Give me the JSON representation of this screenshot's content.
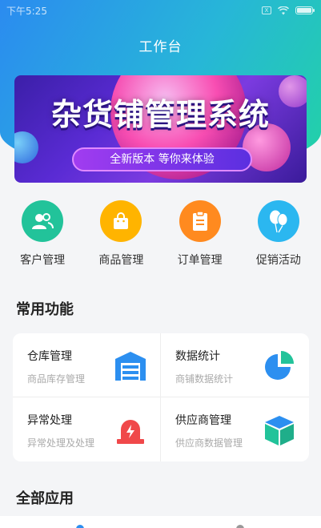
{
  "status_bar": {
    "time": "下午5:25",
    "sim_label": "X"
  },
  "header": {
    "title": "工作台"
  },
  "banner": {
    "title": "杂货铺管理系统",
    "subtitle": "全新版本 等你来体验"
  },
  "quick_actions": [
    {
      "label": "客户管理",
      "icon": "users-icon",
      "color": "#22c39a"
    },
    {
      "label": "商品管理",
      "icon": "shopping-bag-icon",
      "color": "#ffb400"
    },
    {
      "label": "订单管理",
      "icon": "clipboard-icon",
      "color": "#ff8a1f"
    },
    {
      "label": "促销活动",
      "icon": "balloons-icon",
      "color": "#2bb7f0"
    }
  ],
  "common": {
    "title": "常用功能",
    "items": [
      {
        "name": "仓库管理",
        "desc": "商品库存管理",
        "icon": "warehouse-icon"
      },
      {
        "name": "数据统计",
        "desc": "商铺数据统计",
        "icon": "pie-chart-icon"
      },
      {
        "name": "异常处理",
        "desc": "异常处理及处理",
        "icon": "alarm-icon"
      },
      {
        "name": "供应商管理",
        "desc": "供应商数据管理",
        "icon": "cube-icon"
      }
    ]
  },
  "all_apps": {
    "title": "全部应用"
  }
}
